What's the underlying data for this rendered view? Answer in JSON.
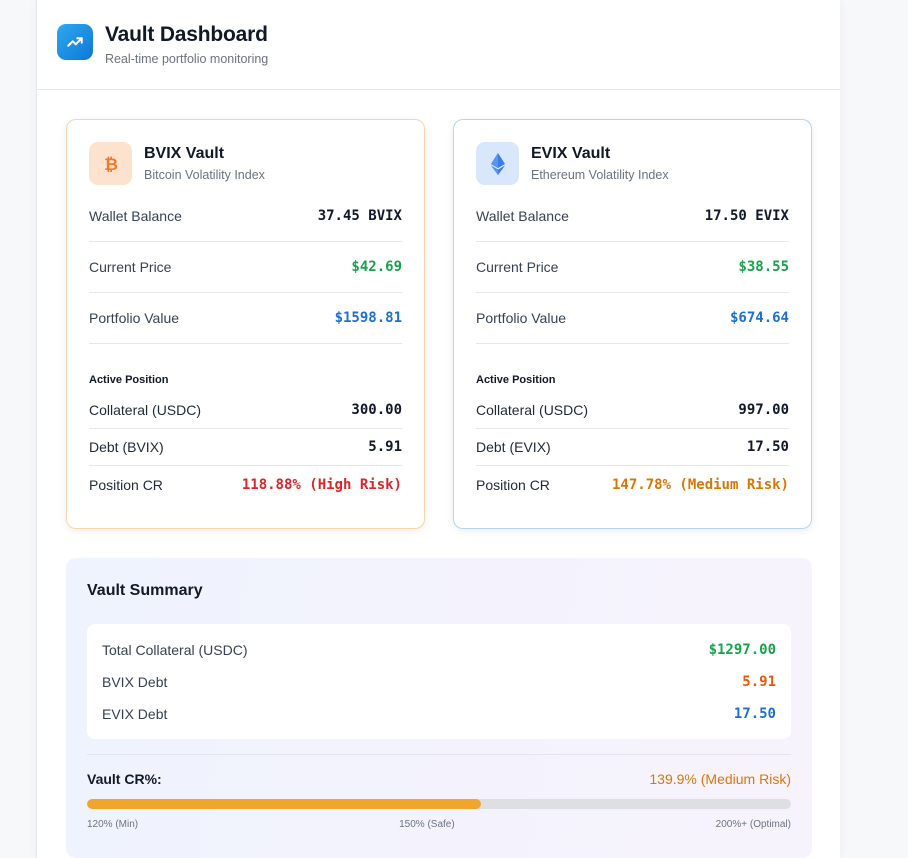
{
  "header": {
    "title": "Vault Dashboard",
    "subtitle": "Real-time portfolio monitoring",
    "icon": "trending-up-icon"
  },
  "colors": {
    "accent": "#1a8be6",
    "positive": "#16a34a",
    "value": "#1d6fd1",
    "high_risk": "#dc2626",
    "medium_risk": "#d97706",
    "progress": "#f0a52d"
  },
  "vaults": [
    {
      "name": "BVIX Vault",
      "description": "Bitcoin Volatility Index",
      "icon": "bitcoin-icon",
      "wallet_label": "Wallet Balance",
      "wallet_value": "37.45 BVIX",
      "price_label": "Current Price",
      "price_value": "$42.69",
      "portfolio_label": "Portfolio Value",
      "portfolio_value": "$1598.81",
      "position_heading": "Active Position",
      "collateral_label": "Collateral (USDC)",
      "collateral_value": "300.00",
      "debt_label": "Debt (BVIX)",
      "debt_value": "5.91",
      "cr_label": "Position CR",
      "cr_value": "118.88% (High Risk)"
    },
    {
      "name": "EVIX Vault",
      "description": "Ethereum Volatility Index",
      "icon": "ethereum-icon",
      "wallet_label": "Wallet Balance",
      "wallet_value": "17.50 EVIX",
      "price_label": "Current Price",
      "price_value": "$38.55",
      "portfolio_label": "Portfolio Value",
      "portfolio_value": "$674.64",
      "position_heading": "Active Position",
      "collateral_label": "Collateral (USDC)",
      "collateral_value": "997.00",
      "debt_label": "Debt (EVIX)",
      "debt_value": "17.50",
      "cr_label": "Position CR",
      "cr_value": "147.78% (Medium Risk)"
    }
  ],
  "summary": {
    "title": "Vault Summary",
    "total_collateral_label": "Total Collateral (USDC)",
    "total_collateral_value": "$1297.00",
    "bvix_debt_label": "BVIX Debt",
    "bvix_debt_value": "5.91",
    "evix_debt_label": "EVIX Debt",
    "evix_debt_value": "17.50",
    "cr_label": "Vault CR%:",
    "cr_value": "139.9% (Medium Risk)",
    "cr_progress_fraction": 0.56,
    "scale_min": "120% (Min)",
    "scale_mid": "150% (Safe)",
    "scale_max": "200%+ (Optimal)"
  }
}
